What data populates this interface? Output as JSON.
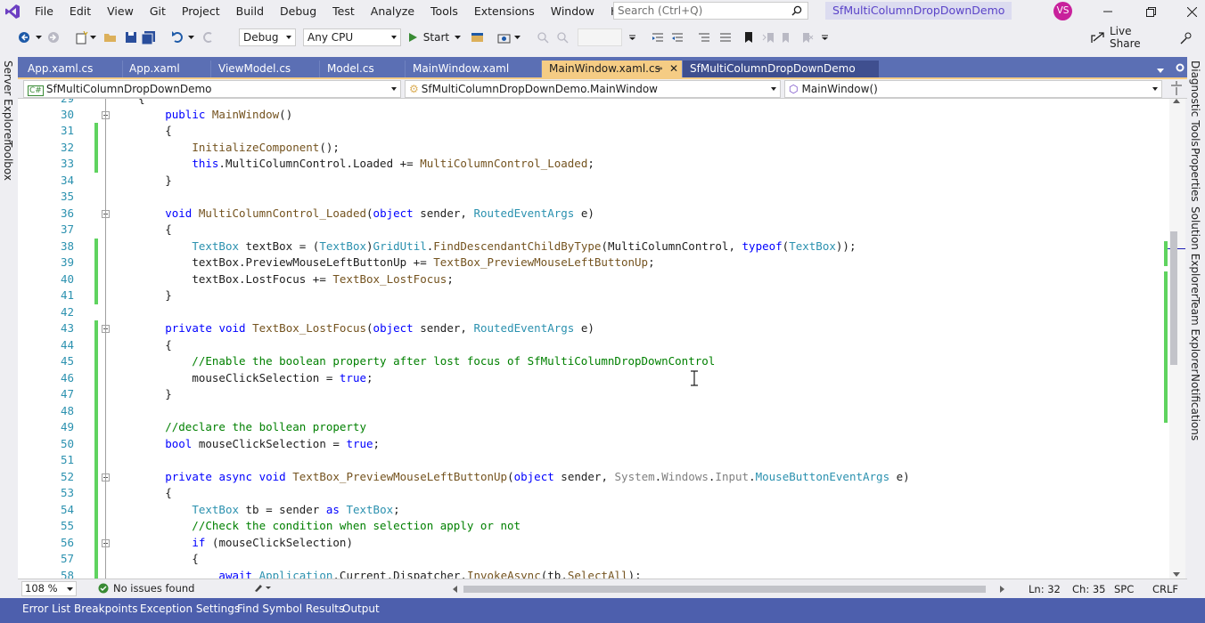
{
  "menu": {
    "items": [
      "File",
      "Edit",
      "View",
      "Git",
      "Project",
      "Build",
      "Debug",
      "Test",
      "Analyze",
      "Tools",
      "Extensions",
      "Window",
      "Help"
    ],
    "search_placeholder": "Search (Ctrl+Q)",
    "solution_title": "SfMultiColumnDropDownDemo",
    "avatar_initials": "VS"
  },
  "toolbar": {
    "config": "Debug",
    "platform": "Any CPU",
    "start_label": "Start",
    "live_share_label": "Live Share"
  },
  "left_rail": [
    "Server Explorer",
    "Toolbox"
  ],
  "right_rail": [
    "Diagnostic Tools",
    "Properties",
    "Solution Explorer",
    "Team Explorer",
    "Notifications"
  ],
  "tabs": [
    {
      "label": "App.xaml.cs"
    },
    {
      "label": "App.xaml"
    },
    {
      "label": "ViewModel.cs"
    },
    {
      "label": "Model.cs"
    },
    {
      "label": "MainWindow.xaml"
    },
    {
      "label": "MainWindow.xaml.cs",
      "active": true
    },
    {
      "label": "SfMultiColumnDropDownDemo"
    }
  ],
  "nav": {
    "project": "SfMultiColumnDropDownDemo",
    "class": "SfMultiColumnDropDownDemo.MainWindow",
    "member": "MainWindow()"
  },
  "code_lines": [
    {
      "n": "30",
      "text": "        public MainWindow()"
    },
    {
      "n": "31",
      "text": "        {"
    },
    {
      "n": "32",
      "text": "            InitializeComponent();"
    },
    {
      "n": "33",
      "text": "            this.MultiColumnControl.Loaded += MultiColumnControl_Loaded;"
    },
    {
      "n": "34",
      "text": "        }"
    },
    {
      "n": "35",
      "text": ""
    },
    {
      "n": "36",
      "text": "        void MultiColumnControl_Loaded(object sender, RoutedEventArgs e)"
    },
    {
      "n": "37",
      "text": "        {"
    },
    {
      "n": "38",
      "text": "            TextBox textBox = (TextBox)GridUtil.FindDescendantChildByType(MultiColumnControl, typeof(TextBox));"
    },
    {
      "n": "39",
      "text": "            textBox.PreviewMouseLeftButtonUp += TextBox_PreviewMouseLeftButtonUp;"
    },
    {
      "n": "40",
      "text": "            textBox.LostFocus += TextBox_LostFocus;"
    },
    {
      "n": "41",
      "text": "        }"
    },
    {
      "n": "42",
      "text": ""
    },
    {
      "n": "43",
      "text": "        private void TextBox_LostFocus(object sender, RoutedEventArgs e)"
    },
    {
      "n": "44",
      "text": "        {"
    },
    {
      "n": "45",
      "text": "            //Enable the boolean property after lost focus of SfMultiColumnDropDownControl"
    },
    {
      "n": "46",
      "text": "            mouseClickSelection = true;"
    },
    {
      "n": "47",
      "text": "        }"
    },
    {
      "n": "48",
      "text": ""
    },
    {
      "n": "49",
      "text": "        //declare the bollean property"
    },
    {
      "n": "50",
      "text": "        bool mouseClickSelection = true;"
    },
    {
      "n": "51",
      "text": ""
    },
    {
      "n": "52",
      "text": "        private async void TextBox_PreviewMouseLeftButtonUp(object sender, System.Windows.Input.MouseButtonEventArgs e)"
    },
    {
      "n": "53",
      "text": "        {"
    },
    {
      "n": "54",
      "text": "            TextBox tb = sender as TextBox;"
    },
    {
      "n": "55",
      "text": "            //Check the condition when selection apply or not"
    },
    {
      "n": "56",
      "text": "            if (mouseClickSelection)"
    },
    {
      "n": "57",
      "text": "            {"
    },
    {
      "n": "58",
      "text": "                await Application.Current.Dispatcher.InvokeAsync(tb.SelectAll);"
    }
  ],
  "status": {
    "zoom": "108 %",
    "issues": "No issues found",
    "ln": "Ln: 32",
    "ch": "Ch: 35",
    "spc": "SPC",
    "crlf": "CRLF"
  },
  "bottom_tabs": [
    "Error List",
    "Breakpoints",
    "Exception Settings",
    "Find Symbol Results",
    "Output"
  ]
}
